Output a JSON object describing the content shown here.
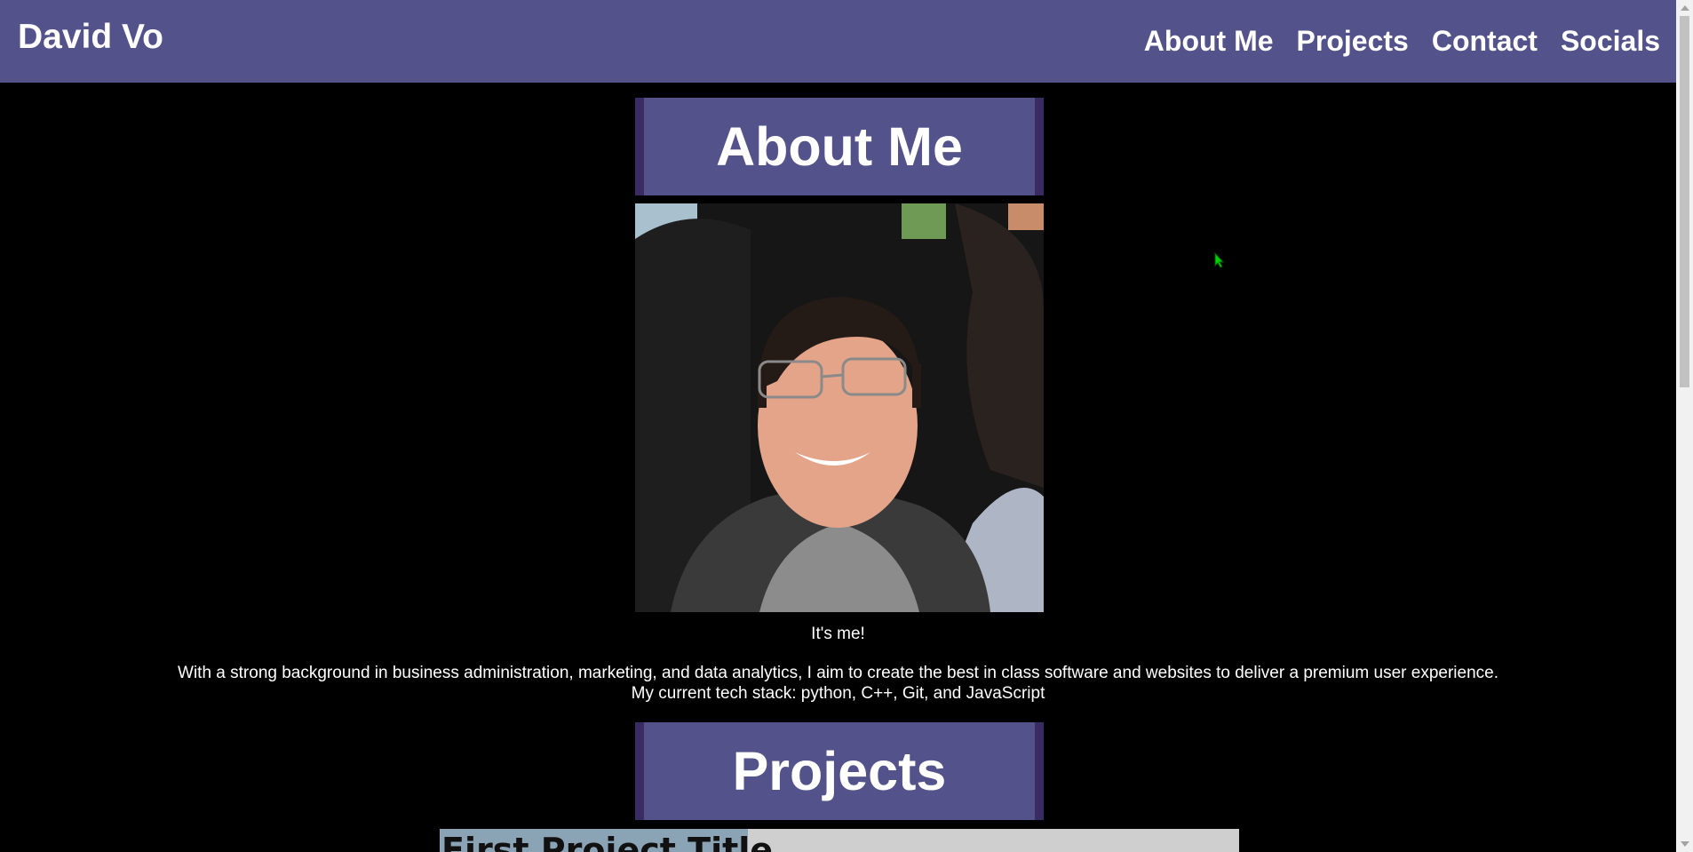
{
  "header": {
    "brand": "David Vo",
    "nav": [
      "About Me",
      "Projects",
      "Contact",
      "Socials"
    ]
  },
  "about": {
    "heading": "About Me",
    "caption": "It's me!",
    "bio_line1": "With a strong background in business administration, marketing, and data analytics, I aim to create the best in class software and websites to deliver a premium user experience.",
    "bio_line2": "My current tech stack: python, C++, Git, and JavaScript"
  },
  "projects": {
    "heading": "Projects",
    "first_title": "First Project Title"
  },
  "colors": {
    "header_bg": "#53528b",
    "heading_border": "#3b2b63",
    "page_bg": "#000000",
    "text": "#ffffff"
  },
  "icons": {
    "cursor": "cursor-arrow-icon"
  }
}
